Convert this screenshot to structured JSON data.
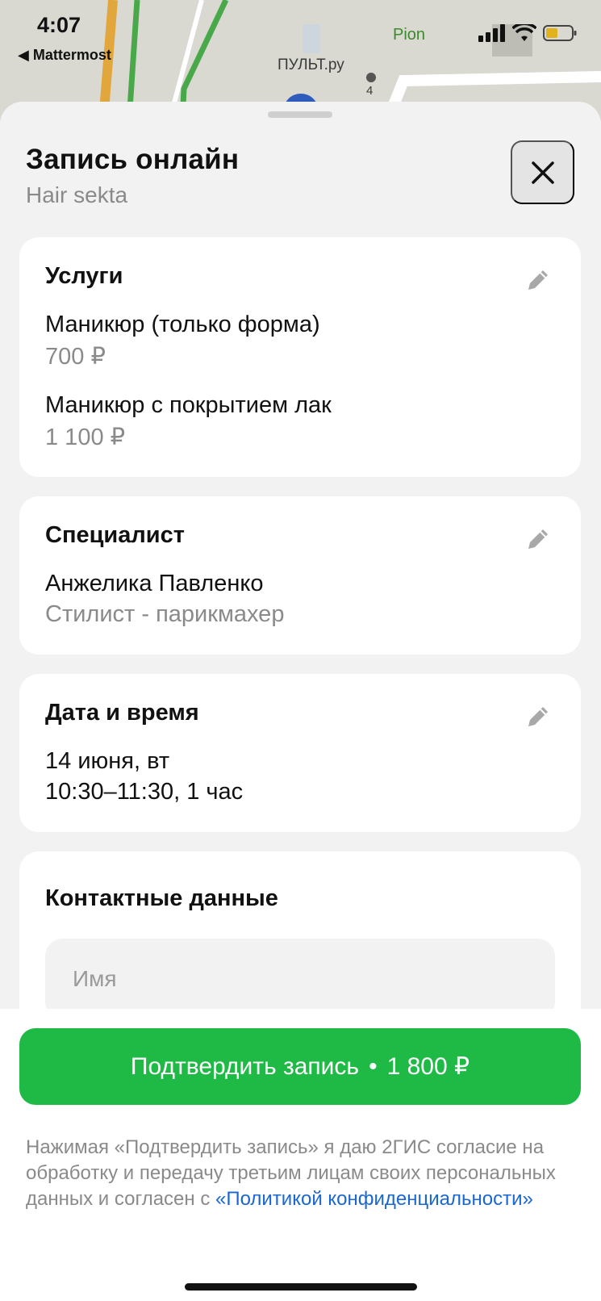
{
  "status_bar": {
    "time": "4:07",
    "back_app": "◀ Mattermost"
  },
  "map": {
    "poi_pion": "Pion",
    "poi_pult": "ПУЛЬТ.ру",
    "house_number": "4"
  },
  "header": {
    "title": "Запись онлайн",
    "subtitle": "Hair sekta"
  },
  "services": {
    "title": "Услуги",
    "items": [
      {
        "name": "Маникюр (только форма)",
        "price": "700 ₽"
      },
      {
        "name": "Маникюр с покрытием лак",
        "price": "1 100 ₽"
      }
    ]
  },
  "specialist": {
    "title": "Специалист",
    "name": "Анжелика Павленко",
    "role": "Стилист - парикмахер"
  },
  "datetime": {
    "title": "Дата и время",
    "date": "14 июня, вт",
    "time": "10:30–11:30, 1 час"
  },
  "contacts": {
    "title": "Контактные данные",
    "name_placeholder": "Имя",
    "name_value": ""
  },
  "confirm": {
    "label": "Подтвердить запись",
    "separator": "•",
    "amount": "1 800 ₽"
  },
  "disclaimer": {
    "text": "Нажимая «Подтвердить запись» я даю 2ГИС согласие на обработку и передачу третьим лицам своих персональных данных и согласен с ",
    "link": "«Политикой конфиденциальности»"
  },
  "colors": {
    "accent_green": "#1fba45",
    "link_blue": "#1a67d2"
  }
}
